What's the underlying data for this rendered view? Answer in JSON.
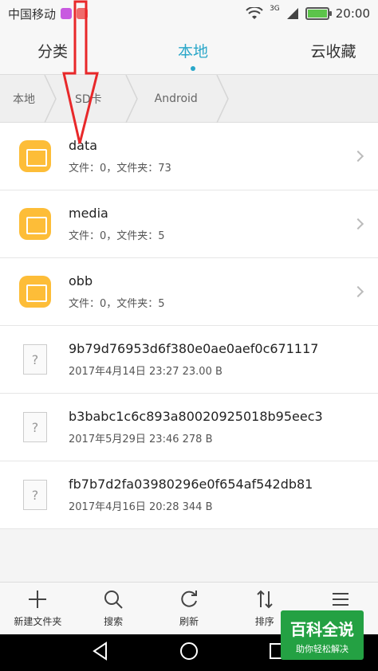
{
  "status_bar": {
    "carrier": "中国移动",
    "network": "3G",
    "time": "20:00"
  },
  "tabs": [
    {
      "label": "分类",
      "active": false
    },
    {
      "label": "本地",
      "active": true
    },
    {
      "label": "云收藏",
      "active": false
    }
  ],
  "breadcrumb": [
    "本地",
    "SD卡",
    "Android"
  ],
  "items": [
    {
      "type": "folder",
      "name": "data",
      "meta": "文件：0，文件夹：73"
    },
    {
      "type": "folder",
      "name": "media",
      "meta": "文件：0，文件夹：5"
    },
    {
      "type": "folder",
      "name": "obb",
      "meta": "文件：0，文件夹：5"
    },
    {
      "type": "file",
      "name": "9b79d76953d6f380e0ae0aef0c671117",
      "meta": "2017年4月14日 23:27 23.00 B"
    },
    {
      "type": "file",
      "name": "b3babc1c6c893a80020925018b95eec3",
      "meta": "2017年5月29日 23:46 278 B"
    },
    {
      "type": "file",
      "name": "fb7b7d2fa03980296e0f654af542db81",
      "meta": "2017年4月16日 20:28 344 B"
    }
  ],
  "toolbar": {
    "new_folder": "新建文件夹",
    "search": "搜索",
    "refresh": "刷新",
    "sort": "排序",
    "more": "更多"
  },
  "watermark": {
    "main": "百科全说",
    "sub": "助你轻松解决"
  },
  "colors": {
    "accent": "#2aa7c9",
    "folder": "#fdbd38",
    "annotation": "#e8282a"
  }
}
